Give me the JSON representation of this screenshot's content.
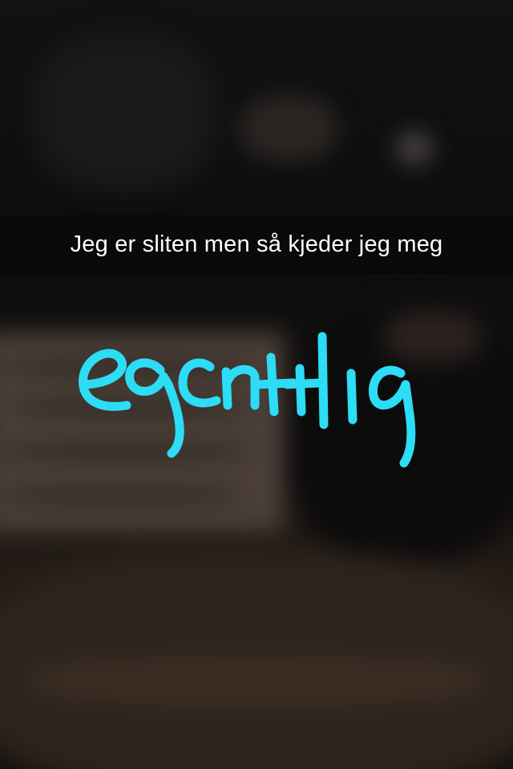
{
  "caption": {
    "text": "Jeg er sliten men så kjeder jeg meg"
  },
  "drawing": {
    "text": "egentlig",
    "color": "#2ddcf5"
  }
}
